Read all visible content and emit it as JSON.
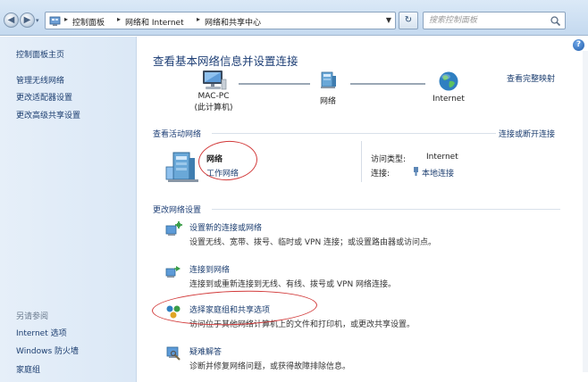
{
  "breadcrumb": {
    "items": [
      "控制面板",
      "网络和 Internet",
      "网络和共享中心"
    ]
  },
  "search": {
    "placeholder": "搜索控制面板"
  },
  "sidebar": {
    "home": "控制面板主页",
    "links": [
      "管理无线网络",
      "更改适配器设置",
      "更改高级共享设置"
    ],
    "see_also_title": "另请参阅",
    "see_also": [
      "Internet 选项",
      "Windows 防火墙",
      "家庭组"
    ]
  },
  "main": {
    "title": "查看基本网络信息并设置连接",
    "view_full_map": "查看完整映射",
    "map": {
      "computer_name": "MAC-PC",
      "computer_sub": "(此计算机)",
      "network": "网络",
      "internet": "Internet"
    },
    "active": {
      "heading": "查看活动网络",
      "connect_link": "连接或断开连接",
      "network_name": "网络",
      "network_type": "工作网络",
      "access_type_label": "访问类型:",
      "access_type_value": "Internet",
      "connection_label": "连接:",
      "connection_value": "本地连接"
    },
    "change": {
      "heading": "更改网络设置",
      "tasks": [
        {
          "link": "设置新的连接或网络",
          "desc": "设置无线、宽带、拨号、临时或 VPN 连接；或设置路由器或访问点。"
        },
        {
          "link": "连接到网络",
          "desc": "连接到或重新连接到无线、有线、拨号或 VPN 网络连接。"
        },
        {
          "link": "选择家庭组和共享选项",
          "desc": "访问位于其他网络计算机上的文件和打印机，或更改共享设置。"
        },
        {
          "link": "疑难解答",
          "desc": "诊断并修复网络问题，或获得故障排除信息。"
        }
      ]
    }
  },
  "colors": {
    "link": "#1c3e70",
    "annotation": "#d23a3a",
    "title": "#1e3f76"
  }
}
